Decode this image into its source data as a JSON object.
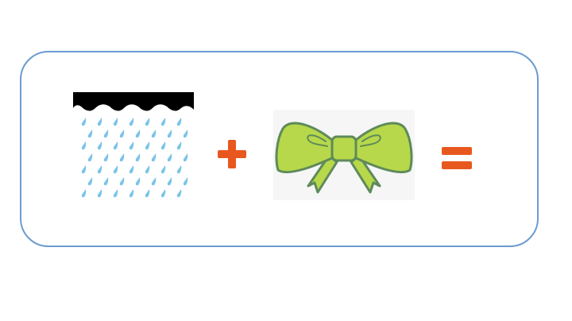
{
  "puzzle": {
    "border_color": "#6b9bd1",
    "operator_color": "#e8581e",
    "items": [
      {
        "icon": "rain-cloud-icon",
        "meaning": "rain"
      },
      {
        "icon": "plus-icon"
      },
      {
        "icon": "bow-icon",
        "meaning": "bow",
        "fill": "#b7d84a",
        "stroke": "#5f8a5a"
      },
      {
        "icon": "equals-icon"
      }
    ],
    "raindrop_color": "#7cc4e8"
  }
}
